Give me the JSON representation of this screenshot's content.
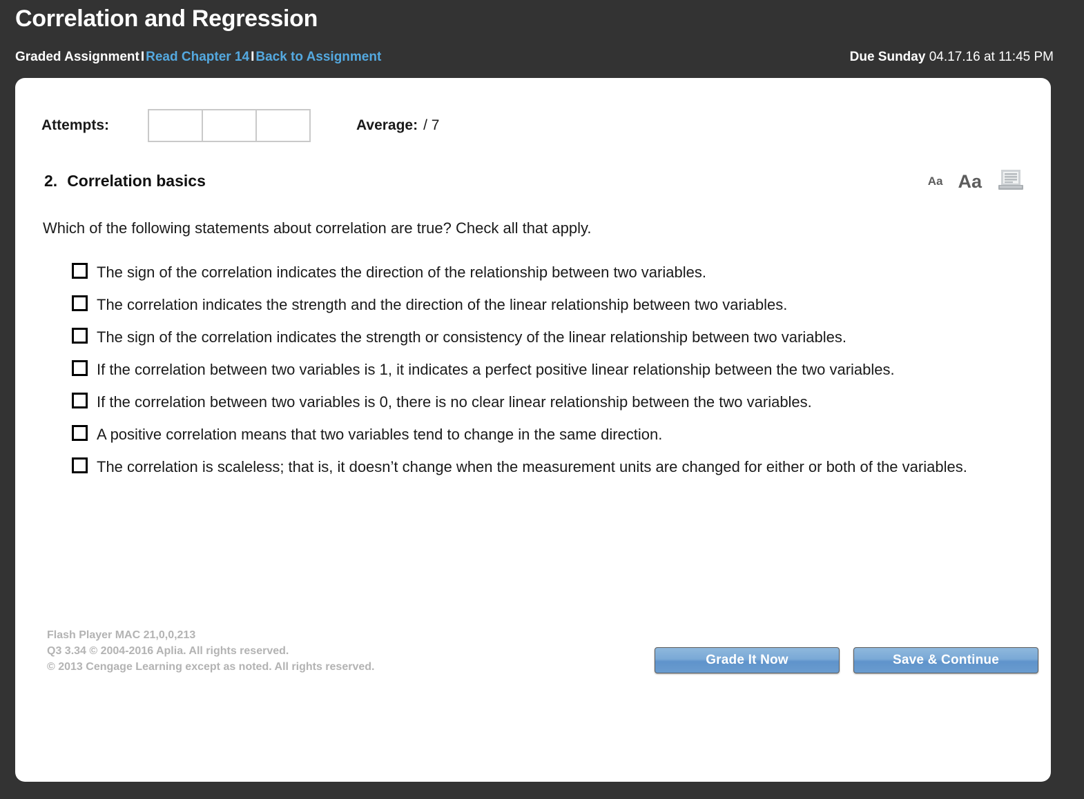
{
  "header": {
    "title": "Correlation and Regression",
    "breadcrumb": {
      "assignment": "Graded Assignment",
      "separator": "I",
      "read_chapter_link": "Read Chapter 14",
      "back_link": "Back to Assignment"
    },
    "due": {
      "label": "Due Sunday",
      "value": "04.17.16 at 11:45 PM"
    },
    "background_color": "#333333",
    "link_color": "#54a9e0"
  },
  "attempts": {
    "label": "Attempts:",
    "boxes": [
      "",
      "",
      ""
    ],
    "average_label": "Average:",
    "average_value": "/ 7"
  },
  "question": {
    "number": "2.",
    "title": "Correlation basics",
    "prompt": "Which of the following statements about correlation are true? Check all that apply.",
    "options": [
      {
        "id": "opt-1",
        "checked": false,
        "text": "The sign of the correlation indicates the direction of the relationship between two variables."
      },
      {
        "id": "opt-2",
        "checked": false,
        "text": "The correlation indicates the strength and the direction of the linear relationship between two variables."
      },
      {
        "id": "opt-3",
        "checked": false,
        "text": "The sign of the correlation indicates the strength or consistency of the linear relationship between two variables."
      },
      {
        "id": "opt-4",
        "checked": false,
        "text": "If the correlation between two variables is 1, it indicates a perfect positive linear relationship between the two variables."
      },
      {
        "id": "opt-5",
        "checked": false,
        "text": "If the correlation between two variables is 0, there is no clear linear relationship between the two variables."
      },
      {
        "id": "opt-6",
        "checked": false,
        "text": "A positive correlation means that two variables tend to change in the same direction."
      },
      {
        "id": "opt-7",
        "checked": false,
        "text": "The correlation is scaleless; that is, it doesn’t change when the measurement units are changed for either or both of the variables."
      }
    ]
  },
  "tools": {
    "decrease_font": "Aa",
    "increase_font": "Aa",
    "print_icon": "printer-icon"
  },
  "footer": {
    "line1": "Flash Player MAC 21,0,0,213",
    "line2": "Q3 3.34 © 2004-2016 Aplia. All rights reserved.",
    "line3": "© 2013 Cengage Learning except as noted. All rights reserved."
  },
  "buttons": {
    "grade": "Grade It Now",
    "save": "Save & Continue",
    "color": "#6f9fd0"
  }
}
